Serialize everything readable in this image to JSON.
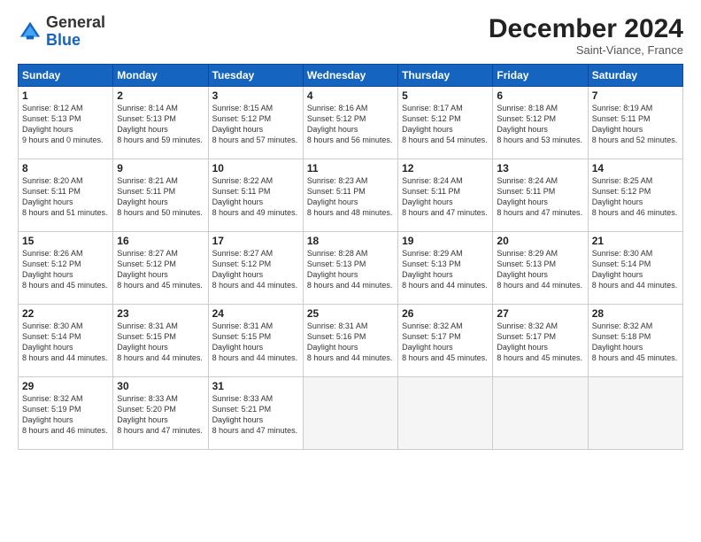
{
  "header": {
    "logo_general": "General",
    "logo_blue": "Blue",
    "month_title": "December 2024",
    "subtitle": "Saint-Viance, France"
  },
  "columns": [
    "Sunday",
    "Monday",
    "Tuesday",
    "Wednesday",
    "Thursday",
    "Friday",
    "Saturday"
  ],
  "weeks": [
    [
      {
        "day": "1",
        "sunrise": "8:12 AM",
        "sunset": "5:13 PM",
        "daylight": "9 hours and 0 minutes."
      },
      {
        "day": "2",
        "sunrise": "8:14 AM",
        "sunset": "5:13 PM",
        "daylight": "8 hours and 59 minutes."
      },
      {
        "day": "3",
        "sunrise": "8:15 AM",
        "sunset": "5:12 PM",
        "daylight": "8 hours and 57 minutes."
      },
      {
        "day": "4",
        "sunrise": "8:16 AM",
        "sunset": "5:12 PM",
        "daylight": "8 hours and 56 minutes."
      },
      {
        "day": "5",
        "sunrise": "8:17 AM",
        "sunset": "5:12 PM",
        "daylight": "8 hours and 54 minutes."
      },
      {
        "day": "6",
        "sunrise": "8:18 AM",
        "sunset": "5:12 PM",
        "daylight": "8 hours and 53 minutes."
      },
      {
        "day": "7",
        "sunrise": "8:19 AM",
        "sunset": "5:11 PM",
        "daylight": "8 hours and 52 minutes."
      }
    ],
    [
      {
        "day": "8",
        "sunrise": "8:20 AM",
        "sunset": "5:11 PM",
        "daylight": "8 hours and 51 minutes."
      },
      {
        "day": "9",
        "sunrise": "8:21 AM",
        "sunset": "5:11 PM",
        "daylight": "8 hours and 50 minutes."
      },
      {
        "day": "10",
        "sunrise": "8:22 AM",
        "sunset": "5:11 PM",
        "daylight": "8 hours and 49 minutes."
      },
      {
        "day": "11",
        "sunrise": "8:23 AM",
        "sunset": "5:11 PM",
        "daylight": "8 hours and 48 minutes."
      },
      {
        "day": "12",
        "sunrise": "8:24 AM",
        "sunset": "5:11 PM",
        "daylight": "8 hours and 47 minutes."
      },
      {
        "day": "13",
        "sunrise": "8:24 AM",
        "sunset": "5:11 PM",
        "daylight": "8 hours and 47 minutes."
      },
      {
        "day": "14",
        "sunrise": "8:25 AM",
        "sunset": "5:12 PM",
        "daylight": "8 hours and 46 minutes."
      }
    ],
    [
      {
        "day": "15",
        "sunrise": "8:26 AM",
        "sunset": "5:12 PM",
        "daylight": "8 hours and 45 minutes."
      },
      {
        "day": "16",
        "sunrise": "8:27 AM",
        "sunset": "5:12 PM",
        "daylight": "8 hours and 45 minutes."
      },
      {
        "day": "17",
        "sunrise": "8:27 AM",
        "sunset": "5:12 PM",
        "daylight": "8 hours and 44 minutes."
      },
      {
        "day": "18",
        "sunrise": "8:28 AM",
        "sunset": "5:13 PM",
        "daylight": "8 hours and 44 minutes."
      },
      {
        "day": "19",
        "sunrise": "8:29 AM",
        "sunset": "5:13 PM",
        "daylight": "8 hours and 44 minutes."
      },
      {
        "day": "20",
        "sunrise": "8:29 AM",
        "sunset": "5:13 PM",
        "daylight": "8 hours and 44 minutes."
      },
      {
        "day": "21",
        "sunrise": "8:30 AM",
        "sunset": "5:14 PM",
        "daylight": "8 hours and 44 minutes."
      }
    ],
    [
      {
        "day": "22",
        "sunrise": "8:30 AM",
        "sunset": "5:14 PM",
        "daylight": "8 hours and 44 minutes."
      },
      {
        "day": "23",
        "sunrise": "8:31 AM",
        "sunset": "5:15 PM",
        "daylight": "8 hours and 44 minutes."
      },
      {
        "day": "24",
        "sunrise": "8:31 AM",
        "sunset": "5:15 PM",
        "daylight": "8 hours and 44 minutes."
      },
      {
        "day": "25",
        "sunrise": "8:31 AM",
        "sunset": "5:16 PM",
        "daylight": "8 hours and 44 minutes."
      },
      {
        "day": "26",
        "sunrise": "8:32 AM",
        "sunset": "5:17 PM",
        "daylight": "8 hours and 45 minutes."
      },
      {
        "day": "27",
        "sunrise": "8:32 AM",
        "sunset": "5:17 PM",
        "daylight": "8 hours and 45 minutes."
      },
      {
        "day": "28",
        "sunrise": "8:32 AM",
        "sunset": "5:18 PM",
        "daylight": "8 hours and 45 minutes."
      }
    ],
    [
      {
        "day": "29",
        "sunrise": "8:32 AM",
        "sunset": "5:19 PM",
        "daylight": "8 hours and 46 minutes."
      },
      {
        "day": "30",
        "sunrise": "8:33 AM",
        "sunset": "5:20 PM",
        "daylight": "8 hours and 47 minutes."
      },
      {
        "day": "31",
        "sunrise": "8:33 AM",
        "sunset": "5:21 PM",
        "daylight": "8 hours and 47 minutes."
      },
      null,
      null,
      null,
      null
    ]
  ]
}
